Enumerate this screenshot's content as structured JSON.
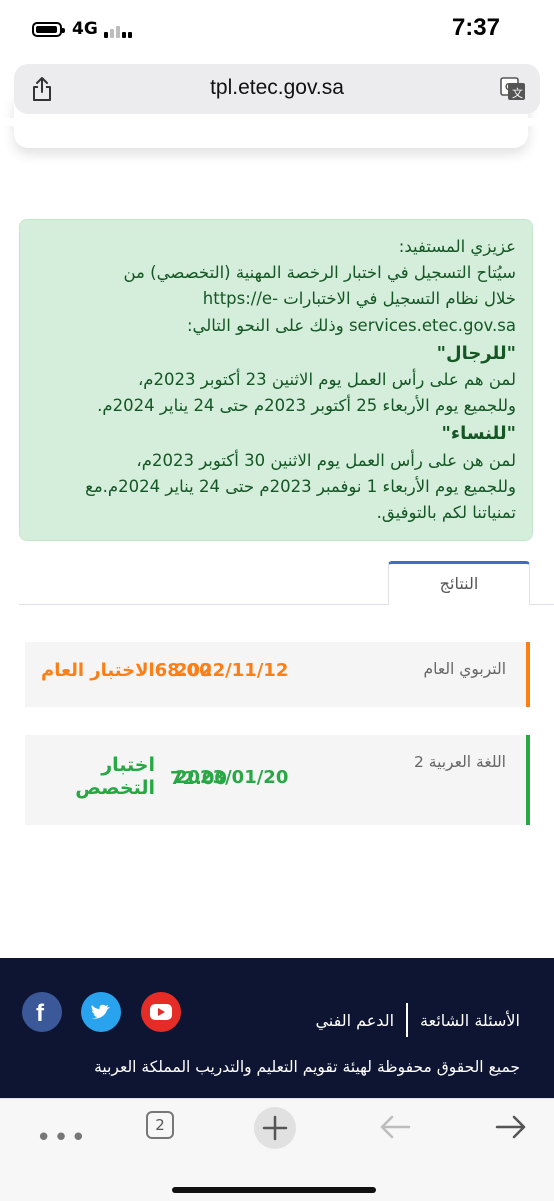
{
  "status_bar": {
    "network": "4G",
    "time": "7:37"
  },
  "browser": {
    "url": "tpl.etec.gov.sa",
    "tab_count": "2",
    "toolbar_icons": [
      "more-icon",
      "tabs-icon",
      "new-tab-icon",
      "back-icon",
      "forward-icon"
    ]
  },
  "notice": {
    "line1": "عزيزي المستفيد:",
    "line2": "سيُتاح التسجيل في اختبار الرخصة المهنية (التخصصي) من",
    "line3": "خلال نظام التسجيل في الاختبارات -https://e",
    "line4": "services.etec.gov.sa وذلك على النحو التالي:",
    "men_heading": "\"للرجال\"",
    "men_line1": "لمن هم على رأس العمل يوم الاثنين 23 أكتوبر 2023م،",
    "men_line2": "وللجميع يوم الأربعاء 25 أكتوبر 2023م حتى 24 يناير 2024م.",
    "women_heading": "\"للنساء\"",
    "women_line1": "لمن هن على رأس العمل يوم الاثنين 30 أكتوبر 2023م،",
    "women_line2": "وللجميع يوم الأربعاء 1 نوفمبر 2023م حتى 24 يناير 2024م.مع",
    "women_line3": "تمنياتنا لكم بالتوفيق."
  },
  "tabs": {
    "results_label": "النتائج"
  },
  "results": [
    {
      "subject": "التربوي العام",
      "date": "2022/11/12",
      "score": "68.00",
      "type": "الاختبار العام",
      "accent": "#fd7e14"
    },
    {
      "subject": "اللغة العربية 2",
      "date": "2023/01/20",
      "score": "72.00",
      "type": "اختبار التخصص",
      "accent": "#28a745"
    }
  ],
  "footer": {
    "faq_link": "الأسئلة الشائعة",
    "support_link": "الدعم الفني",
    "copyright": "جميع الحقوق محفوظة لهيئة تقويم التعليم والتدريب المملكة العربية",
    "social_icons": [
      "facebook-icon",
      "twitter-icon",
      "youtube-icon"
    ]
  },
  "colors": {
    "alert_bg": "#d5eedb",
    "alert_text": "#155724",
    "footer_bg": "#0e1533",
    "tab_accent": "#3b6fc4"
  }
}
